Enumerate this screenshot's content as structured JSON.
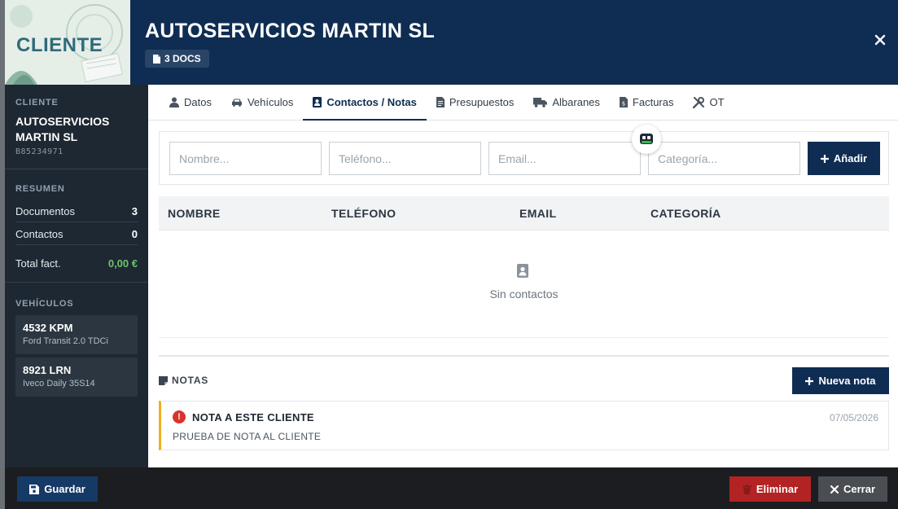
{
  "header": {
    "thumb_label": "CLIENTE",
    "title": "AUTOSERVICIOS MARTIN SL",
    "docs_badge": "3 DOCS",
    "close_icon": "close-icon"
  },
  "sidebar": {
    "client_section": "CLIENTE",
    "client_name": "AUTOSERVICIOS MARTIN SL",
    "client_id": "B85234971",
    "summary_section": "RESUMEN",
    "summary": [
      {
        "label": "Documentos",
        "value": "3"
      },
      {
        "label": "Contactos",
        "value": "0"
      },
      {
        "label": "Total fact.",
        "value": "0,00 €"
      }
    ],
    "vehicles_section": "VEHÍCULOS",
    "vehicles": [
      {
        "plate": "4532 KPM",
        "model": "Ford Transit 2.0 TDCi"
      },
      {
        "plate": "8921 LRN",
        "model": "Iveco Daily 35S14"
      }
    ]
  },
  "tabs": [
    {
      "label": "Datos",
      "icon": "user-icon"
    },
    {
      "label": "Vehículos",
      "icon": "car-icon"
    },
    {
      "label": "Contactos / Notas",
      "icon": "address-book-icon",
      "active": true
    },
    {
      "label": "Presupuestos",
      "icon": "document-icon"
    },
    {
      "label": "Albaranes",
      "icon": "truck-icon"
    },
    {
      "label": "Facturas",
      "icon": "invoice-icon"
    },
    {
      "label": "OT",
      "icon": "tools-icon"
    }
  ],
  "contact_form": {
    "name_placeholder": "Nombre...",
    "phone_placeholder": "Teléfono...",
    "email_placeholder": "Email...",
    "category_placeholder": "Categoría...",
    "add_label": "Añadir"
  },
  "contacts_table": {
    "columns": [
      "NOMBRE",
      "TELÉFONO",
      "EMAIL",
      "CATEGORÍA"
    ],
    "rows": [],
    "empty_text": "Sin contactos"
  },
  "notes": {
    "section_title": "NOTAS",
    "new_note_label": "Nueva nota",
    "items": [
      {
        "title": "NOTA A ESTE CLIENTE",
        "date": "07/05/2026",
        "body": "PRUEBA DE NOTA AL CLIENTE"
      }
    ]
  },
  "footer": {
    "save_label": "Guardar",
    "delete_label": "Eliminar",
    "close_label": "Cerrar"
  },
  "colors": {
    "primary": "#0f2d52",
    "danger": "#b42323",
    "success": "#6fc26f",
    "note_accent": "#f0ad1c"
  }
}
